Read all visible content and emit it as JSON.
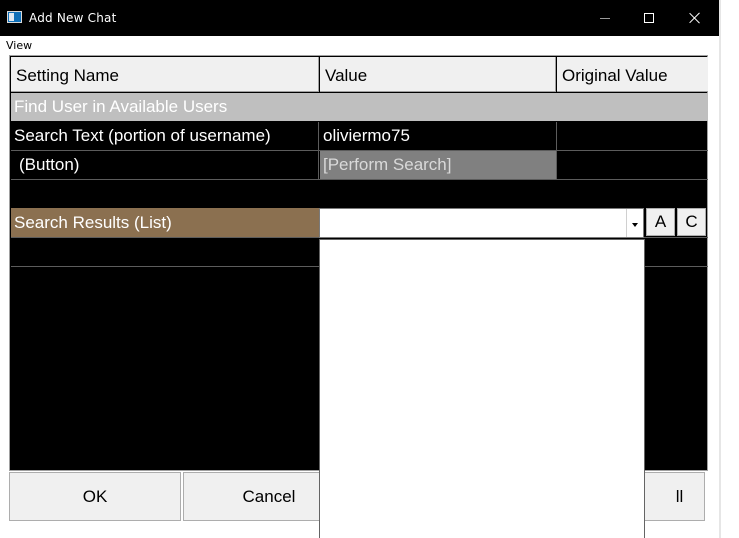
{
  "window": {
    "title": "Add New Chat"
  },
  "menu": {
    "view": "View"
  },
  "grid": {
    "headers": [
      "Setting Name",
      "Value",
      "Original Value"
    ],
    "section_title": "Find User in Available Users",
    "search_row": {
      "name": "Search Text (portion of username)",
      "value": "oliviermo75",
      "original": ""
    },
    "button_row": {
      "name": "(Button)",
      "value": "[Perform Search]",
      "original": ""
    },
    "results_row": {
      "name": "Search Results (List)",
      "selected": ""
    }
  },
  "side_buttons": {
    "a": "A",
    "c": "C"
  },
  "footer": {
    "ok": "OK",
    "cancel": "Cancel",
    "third_partial": "ll"
  },
  "colors": {
    "section_bg": "#bfbfbf",
    "button_cell_bg": "#808080",
    "results_label_bg": "#8b7050",
    "grid_bg": "#000000"
  }
}
